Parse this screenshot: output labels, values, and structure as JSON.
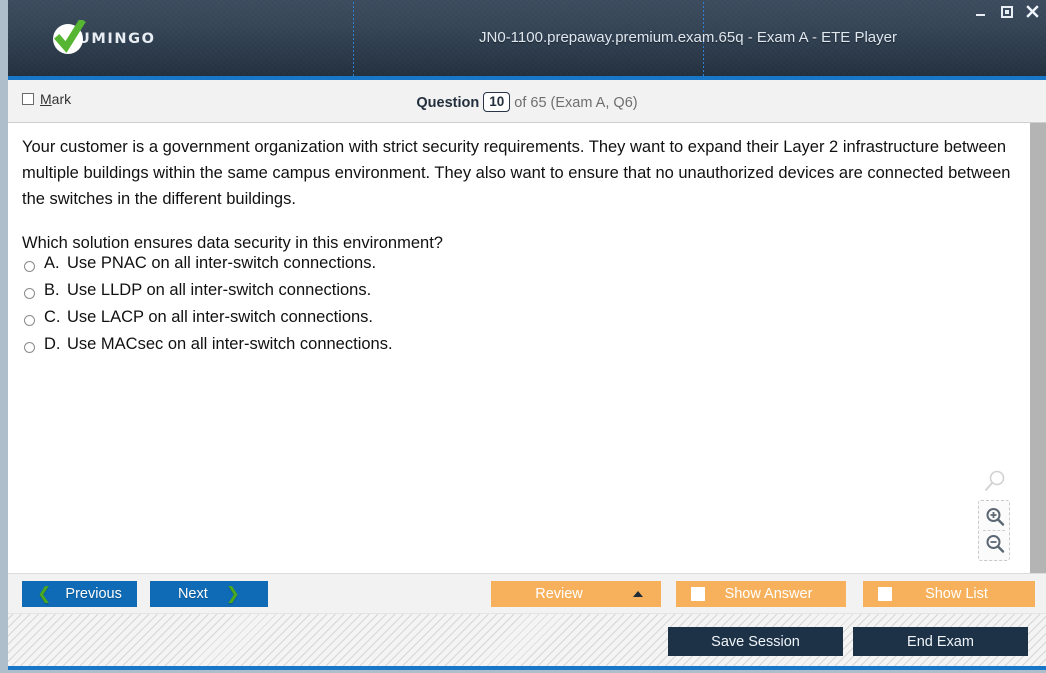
{
  "window": {
    "title": "JN0-1100.prepaway.premium.exam.65q - Exam A - ETE Player",
    "logo_text": "UMINGO",
    "controls": {
      "minimize": "minimize-icon",
      "maximize": "maximize-icon",
      "close": "close-icon"
    },
    "accent_blue": "#1877c9",
    "header_dark": "#2a3848"
  },
  "question_strip": {
    "mark_label_prefix": "",
    "mark_label_accel": "M",
    "mark_label_rest": "ark",
    "mark_checked": false,
    "question_word": "Question",
    "question_number": "10",
    "rest": "of 65 (Exam A, Q6)"
  },
  "question": {
    "paragraphs": [
      "Your customer is a government organization with strict security requirements. They want to expand their Layer 2 infrastructure between multiple buildings within the same campus environment. They also want to ensure that no unauthorized devices are connected between the switches in the different buildings.",
      "Which solution ensures data security in this environment?"
    ],
    "answers": [
      {
        "letter": "A.",
        "text": "Use PNAC on all inter-switch connections.",
        "selected": false
      },
      {
        "letter": "B.",
        "text": "Use LLDP on all inter-switch connections.",
        "selected": false
      },
      {
        "letter": "C.",
        "text": "Use LACP on all inter-switch connections.",
        "selected": false
      },
      {
        "letter": "D.",
        "text": "Use MACsec on all inter-switch connections.",
        "selected": false
      }
    ]
  },
  "zoom_controls": {
    "ghost_icon": "magnifier-icon",
    "zoom_in_icon": "zoom-in-icon",
    "zoom_out_icon": "zoom-out-icon"
  },
  "toolbar": {
    "previous_label": "Previous",
    "next_label": "Next",
    "review_label": "Review",
    "show_answer_label": "Show Answer",
    "show_list_label": "Show List",
    "show_answer_checked": false,
    "show_list_checked": false,
    "blue_color": "#0f6bb5",
    "orange_color": "#f7b15c",
    "chevron_color": "#4aa81e"
  },
  "footer": {
    "save_session_label": "Save Session",
    "end_exam_label": "End Exam",
    "navy_color": "#1d3247"
  }
}
